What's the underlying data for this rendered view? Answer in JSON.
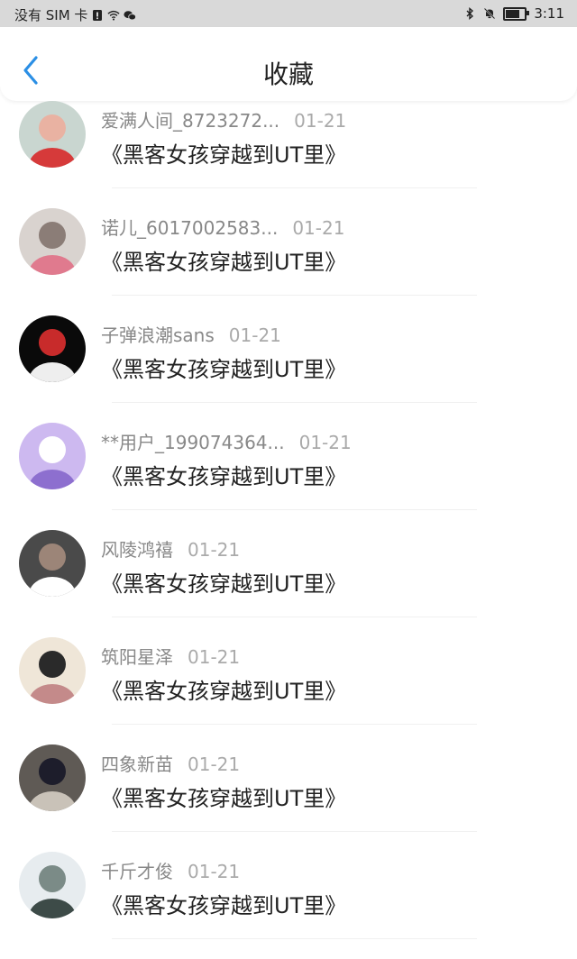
{
  "status_bar": {
    "carrier": "没有 SIM 卡",
    "time": "3:11",
    "battery_level": 0.85,
    "icons": [
      "sim-alert-icon",
      "wifi-icon",
      "wechat-icon",
      "bluetooth-icon",
      "mute-bell-icon",
      "battery-icon"
    ]
  },
  "header": {
    "title": "收藏",
    "back_icon": "chevron-left-icon",
    "accent_color": "#2b8fe5"
  },
  "favorites": [
    {
      "user": "爱满人间_8723272...",
      "date": "01-21",
      "book": "《黑客女孩穿越到UT里》",
      "avatar_colors": [
        "#c9d6d0",
        "#e9b2a2",
        "#d63a3a"
      ]
    },
    {
      "user": "诺儿_6017002583...",
      "date": "01-21",
      "book": "《黑客女孩穿越到UT里》",
      "avatar_colors": [
        "#d9d3cf",
        "#8b7d77",
        "#e07a8e"
      ]
    },
    {
      "user": "子弹浪潮sans",
      "date": "01-21",
      "book": "《黑客女孩穿越到UT里》",
      "avatar_colors": [
        "#0a0a0a",
        "#c82b2b",
        "#eeeeee"
      ]
    },
    {
      "user": "**用户_199074364...",
      "date": "01-21",
      "book": "《黑客女孩穿越到UT里》",
      "avatar_colors": [
        "#cdb9f0",
        "#ffffff",
        "#8d6fcf"
      ]
    },
    {
      "user": "风陵鸿禧",
      "date": "01-21",
      "book": "《黑客女孩穿越到UT里》",
      "avatar_colors": [
        "#4a4a4a",
        "#9c8578",
        "#ffffff"
      ]
    },
    {
      "user": "筑阳星泽",
      "date": "01-21",
      "book": "《黑客女孩穿越到UT里》",
      "avatar_colors": [
        "#efe6d8",
        "#2a2a2a",
        "#c48a8a"
      ]
    },
    {
      "user": "四象新苗",
      "date": "01-21",
      "book": "《黑客女孩穿越到UT里》",
      "avatar_colors": [
        "#5f5a55",
        "#1d1d2b",
        "#c9c2b8"
      ]
    },
    {
      "user": "千斤才俊",
      "date": "01-21",
      "book": "《黑客女孩穿越到UT里》",
      "avatar_colors": [
        "#e7ecef",
        "#7b8b87",
        "#3d4b48"
      ]
    }
  ]
}
